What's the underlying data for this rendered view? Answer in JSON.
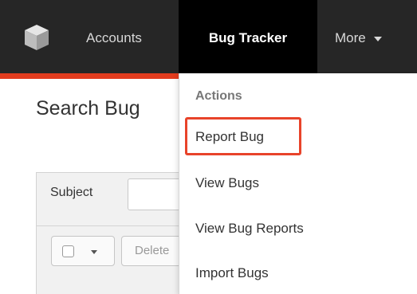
{
  "navbar": {
    "logo_icon": "cube-logo-icon",
    "items": [
      {
        "label": "Accounts"
      },
      {
        "label": "Bug Tracker"
      },
      {
        "label": "More"
      }
    ],
    "more_icon": "caret-down-icon",
    "accent_color": "#e23c1e",
    "active_bg": "#000000"
  },
  "page": {
    "title": "Search Bug"
  },
  "search": {
    "subject_label": "Subject",
    "subject_value": "",
    "delete_label": "Delete"
  },
  "dropdown": {
    "header": "Actions",
    "items": [
      {
        "label": "Report Bug"
      },
      {
        "label": "View Bugs"
      },
      {
        "label": "View Bug Reports"
      },
      {
        "label": "Import Bugs"
      }
    ],
    "highlight_color": "#e8432a"
  }
}
